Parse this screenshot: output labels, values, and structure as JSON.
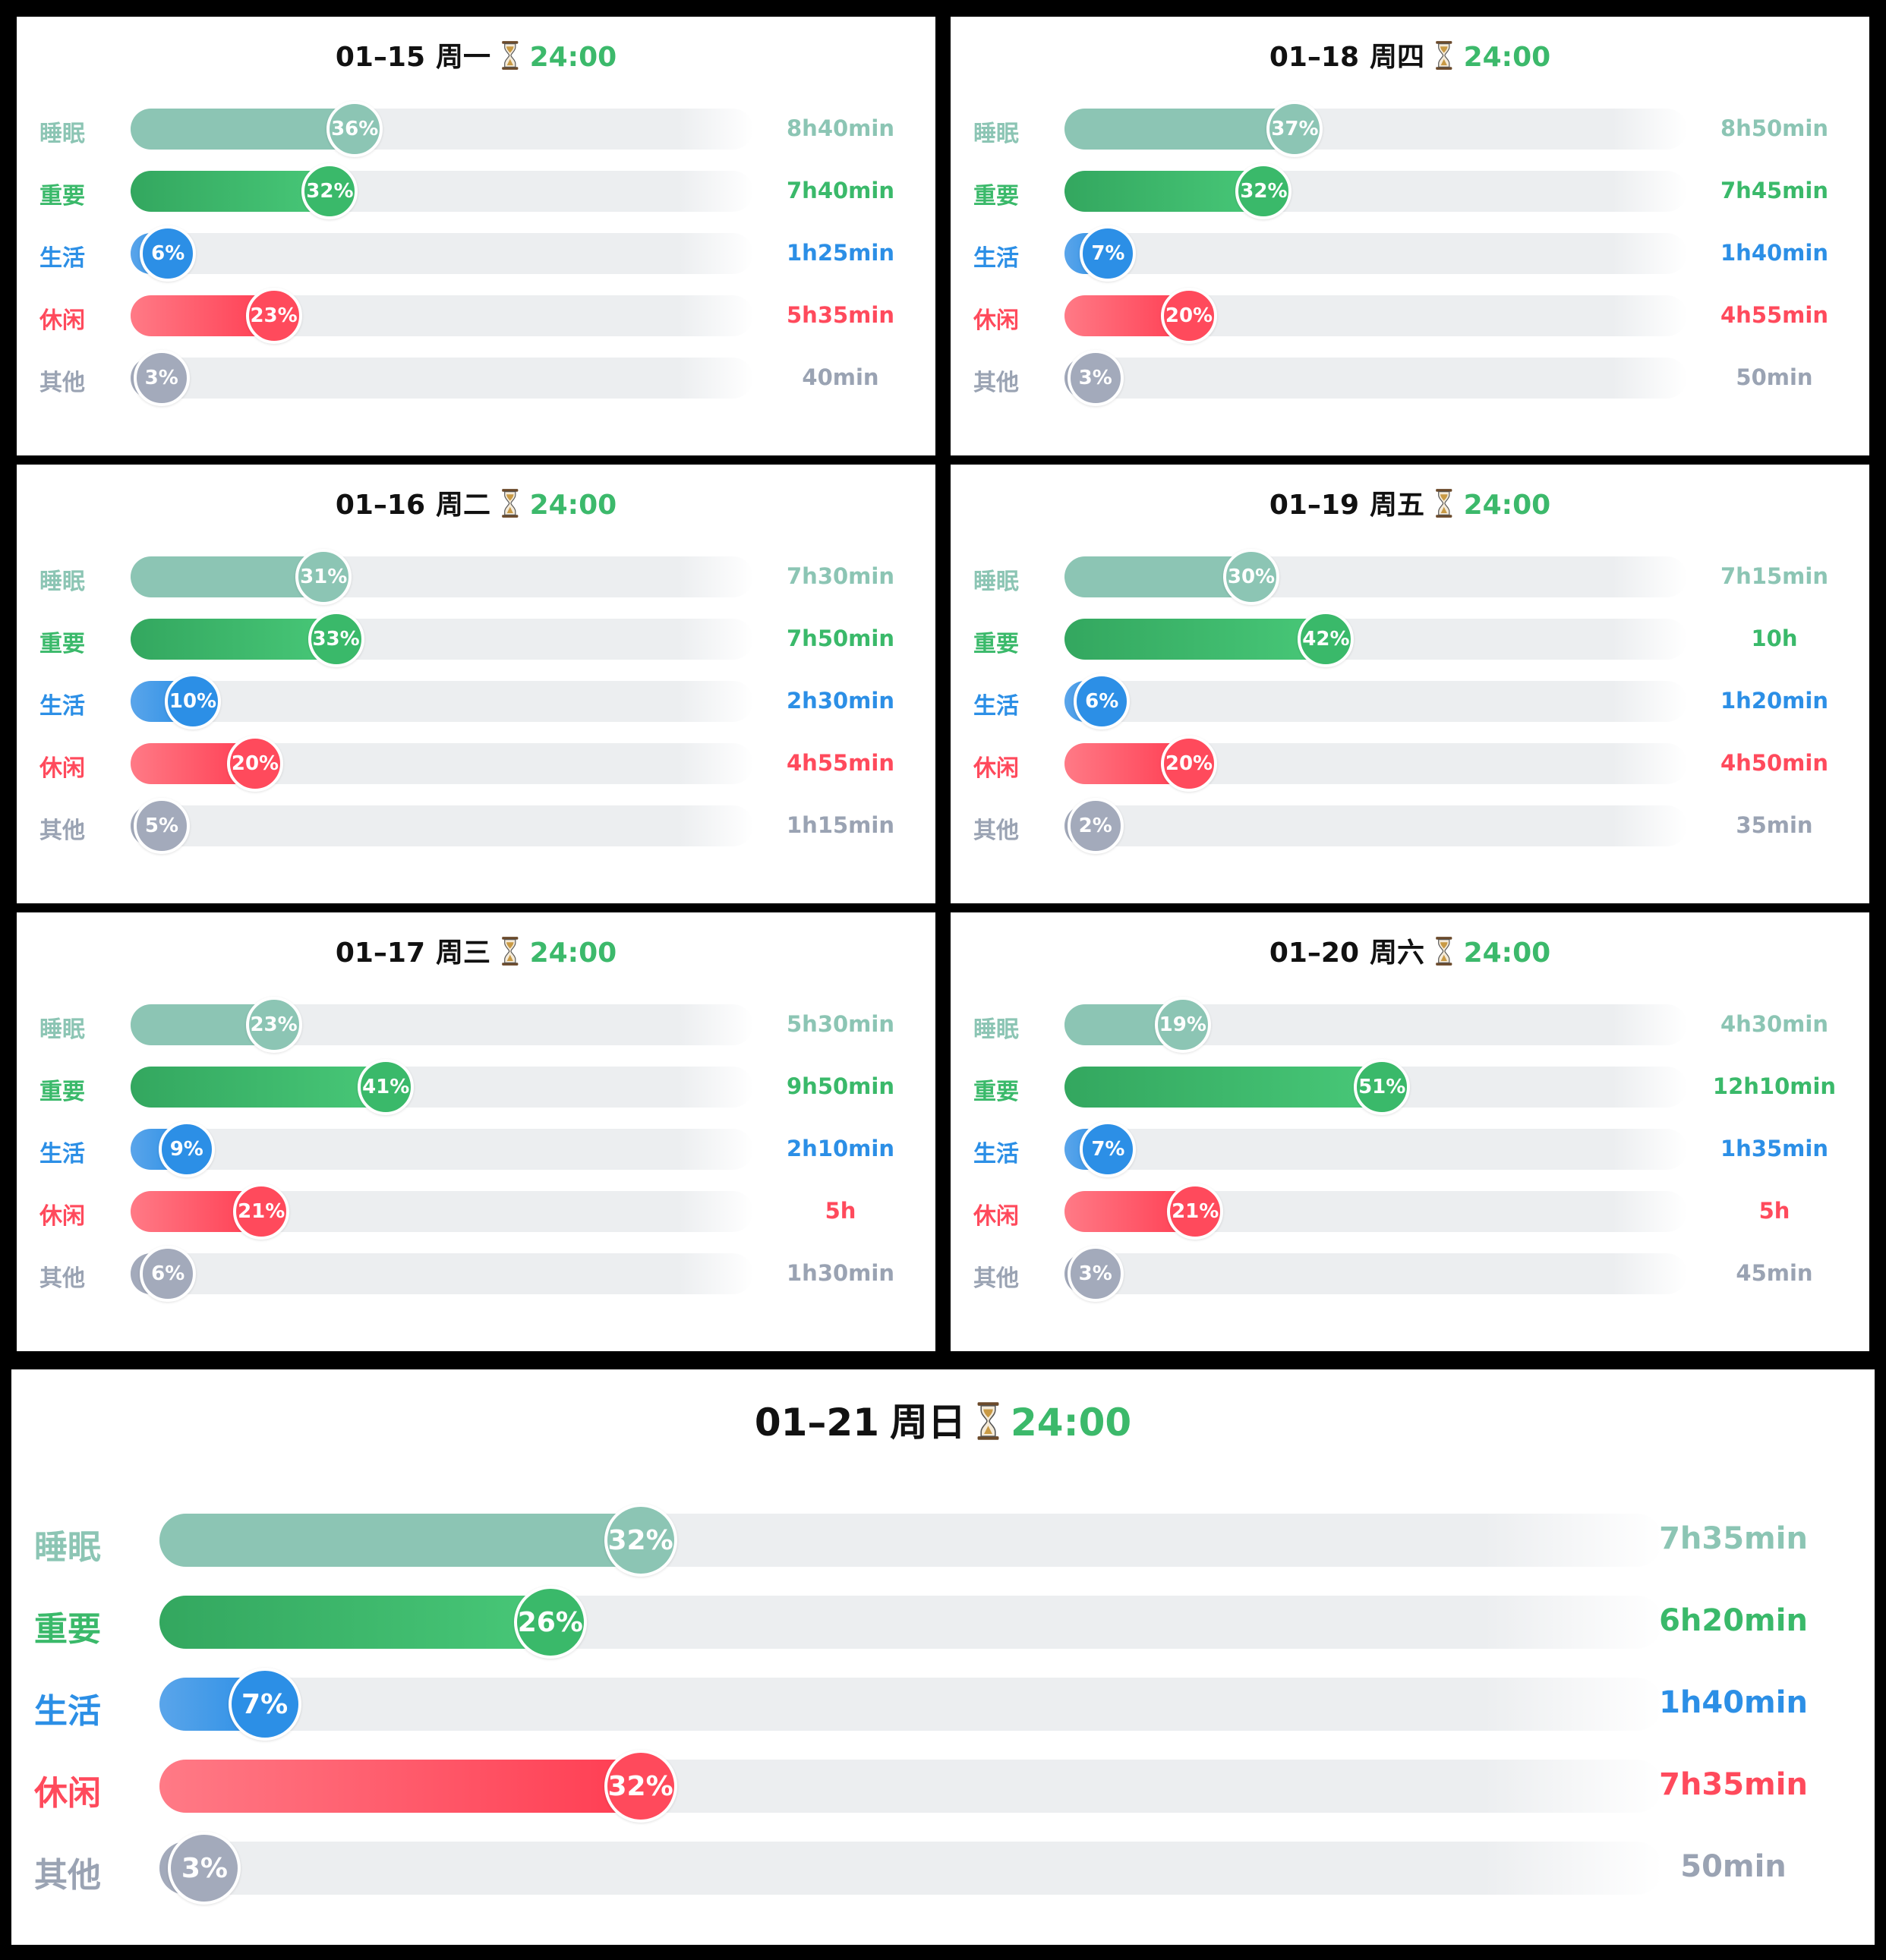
{
  "time_symbol": "24:00",
  "colors": {
    "sleep": "#8cc5b4",
    "important": "#3ab96a",
    "life": "#2c8fe6",
    "leisure": "#ff4a5c",
    "other": "#a3aabb"
  },
  "categories": [
    {
      "key": "sleep",
      "label": "睡眠"
    },
    {
      "key": "important",
      "label": "重要"
    },
    {
      "key": "life",
      "label": "生活"
    },
    {
      "key": "leisure",
      "label": "休闲"
    },
    {
      "key": "other",
      "label": "其他"
    }
  ],
  "days": [
    {
      "date": "01–15",
      "weekday": "周一",
      "total": "24:00",
      "rows": [
        {
          "key": "sleep",
          "label": "睡眠",
          "percent": "36%",
          "duration": "8h40min"
        },
        {
          "key": "important",
          "label": "重要",
          "percent": "32%",
          "duration": "7h40min"
        },
        {
          "key": "life",
          "label": "生活",
          "percent": "6%",
          "duration": "1h25min"
        },
        {
          "key": "leisure",
          "label": "休闲",
          "percent": "23%",
          "duration": "5h35min"
        },
        {
          "key": "other",
          "label": "其他",
          "percent": "3%",
          "duration": "40min"
        }
      ]
    },
    {
      "date": "01–18",
      "weekday": "周四",
      "total": "24:00",
      "rows": [
        {
          "key": "sleep",
          "label": "睡眠",
          "percent": "37%",
          "duration": "8h50min"
        },
        {
          "key": "important",
          "label": "重要",
          "percent": "32%",
          "duration": "7h45min"
        },
        {
          "key": "life",
          "label": "生活",
          "percent": "7%",
          "duration": "1h40min"
        },
        {
          "key": "leisure",
          "label": "休闲",
          "percent": "20%",
          "duration": "4h55min"
        },
        {
          "key": "other",
          "label": "其他",
          "percent": "3%",
          "duration": "50min"
        }
      ]
    },
    {
      "date": "01–16",
      "weekday": "周二",
      "total": "24:00",
      "rows": [
        {
          "key": "sleep",
          "label": "睡眠",
          "percent": "31%",
          "duration": "7h30min"
        },
        {
          "key": "important",
          "label": "重要",
          "percent": "33%",
          "duration": "7h50min"
        },
        {
          "key": "life",
          "label": "生活",
          "percent": "10%",
          "duration": "2h30min"
        },
        {
          "key": "leisure",
          "label": "休闲",
          "percent": "20%",
          "duration": "4h55min"
        },
        {
          "key": "other",
          "label": "其他",
          "percent": "5%",
          "duration": "1h15min"
        }
      ]
    },
    {
      "date": "01–19",
      "weekday": "周五",
      "total": "24:00",
      "rows": [
        {
          "key": "sleep",
          "label": "睡眠",
          "percent": "30%",
          "duration": "7h15min"
        },
        {
          "key": "important",
          "label": "重要",
          "percent": "42%",
          "duration": "10h"
        },
        {
          "key": "life",
          "label": "生活",
          "percent": "6%",
          "duration": "1h20min"
        },
        {
          "key": "leisure",
          "label": "休闲",
          "percent": "20%",
          "duration": "4h50min"
        },
        {
          "key": "other",
          "label": "其他",
          "percent": "2%",
          "duration": "35min"
        }
      ]
    },
    {
      "date": "01–17",
      "weekday": "周三",
      "total": "24:00",
      "rows": [
        {
          "key": "sleep",
          "label": "睡眠",
          "percent": "23%",
          "duration": "5h30min"
        },
        {
          "key": "important",
          "label": "重要",
          "percent": "41%",
          "duration": "9h50min"
        },
        {
          "key": "life",
          "label": "生活",
          "percent": "9%",
          "duration": "2h10min"
        },
        {
          "key": "leisure",
          "label": "休闲",
          "percent": "21%",
          "duration": "5h"
        },
        {
          "key": "other",
          "label": "其他",
          "percent": "6%",
          "duration": "1h30min"
        }
      ]
    },
    {
      "date": "01–20",
      "weekday": "周六",
      "total": "24:00",
      "rows": [
        {
          "key": "sleep",
          "label": "睡眠",
          "percent": "19%",
          "duration": "4h30min"
        },
        {
          "key": "important",
          "label": "重要",
          "percent": "51%",
          "duration": "12h10min"
        },
        {
          "key": "life",
          "label": "生活",
          "percent": "7%",
          "duration": "1h35min"
        },
        {
          "key": "leisure",
          "label": "休闲",
          "percent": "21%",
          "duration": "5h"
        },
        {
          "key": "other",
          "label": "其他",
          "percent": "3%",
          "duration": "45min"
        }
      ]
    },
    {
      "date": "01–21",
      "weekday": "周日",
      "total": "24:00",
      "rows": [
        {
          "key": "sleep",
          "label": "睡眠",
          "percent": "32%",
          "duration": "7h35min"
        },
        {
          "key": "important",
          "label": "重要",
          "percent": "26%",
          "duration": "6h20min"
        },
        {
          "key": "life",
          "label": "生活",
          "percent": "7%",
          "duration": "1h40min"
        },
        {
          "key": "leisure",
          "label": "休闲",
          "percent": "32%",
          "duration": "7h35min"
        },
        {
          "key": "other",
          "label": "其他",
          "percent": "3%",
          "duration": "50min"
        }
      ]
    }
  ]
}
